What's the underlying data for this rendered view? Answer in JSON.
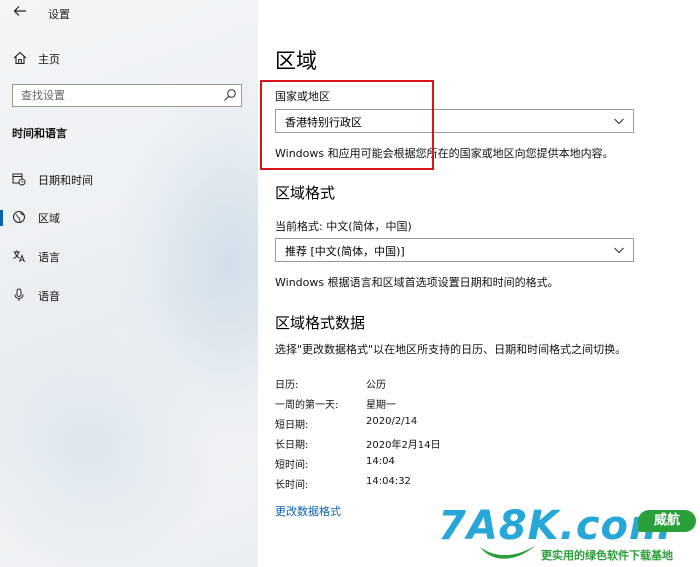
{
  "window": {
    "title": "设置",
    "back_icon": "back-arrow-icon"
  },
  "sidebar": {
    "home_label": "主页",
    "search_placeholder": "查找设置",
    "section_title": "时间和语言",
    "items": [
      {
        "label": "日期和时间",
        "icon": "calendar-clock-icon",
        "active": false
      },
      {
        "label": "区域",
        "icon": "globe-region-icon",
        "active": true
      },
      {
        "label": "语言",
        "icon": "language-icon",
        "active": false
      },
      {
        "label": "语音",
        "icon": "microphone-icon",
        "active": false
      }
    ]
  },
  "main": {
    "page_title": "区域",
    "country": {
      "label": "国家或地区",
      "value": "香港特别行政区",
      "description": "Windows 和应用可能会根据您所在的国家或地区向您提供本地内容。"
    },
    "format": {
      "title": "区域格式",
      "current_label": "当前格式: 中文(简体，中国)",
      "value": "推荐 [中文(简体，中国)]",
      "description": "Windows 根据语言和区域首选项设置日期和时间的格式。"
    },
    "format_data": {
      "title": "区域格式数据",
      "description": "选择\"更改数据格式\"以在地区所支持的日历、日期和时间格式之间切换。",
      "rows": [
        {
          "key": "日历:",
          "value": "公历"
        },
        {
          "key": "一周的第一天:",
          "value": "星期一"
        },
        {
          "key": "短日期:",
          "value": "2020/2/14"
        },
        {
          "key": "长日期:",
          "value": "2020年2月14日"
        },
        {
          "key": "短时间:",
          "value": "14:04"
        },
        {
          "key": "长时间:",
          "value": "14:04:32"
        }
      ],
      "change_link": "更改数据格式"
    }
  },
  "watermark": {
    "brand": "7A8K.com",
    "badge": "威航",
    "tagline": "更实用的绿色软件下载基地"
  },
  "colors": {
    "accent": "#0a64ad",
    "highlight_box": "#d6141c",
    "watermark_blue": "#27a7d8",
    "watermark_green": "#2b9f3a"
  }
}
